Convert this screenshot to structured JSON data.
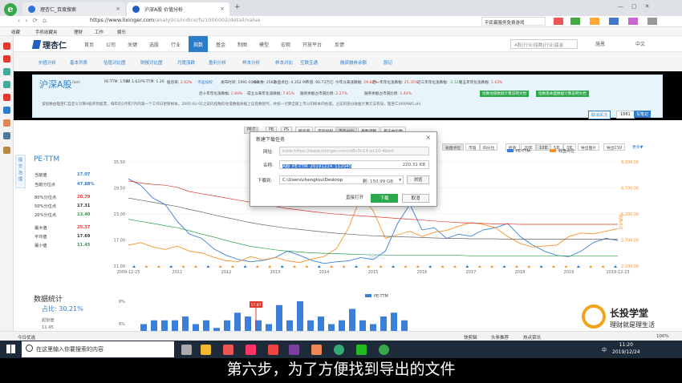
{
  "browser": {
    "tabs": [
      {
        "label": "理杏仁_百度搜索",
        "icon_color": "#2f6fd8"
      },
      {
        "label": "沪深A股 价值分析",
        "icon_color": "#1f5fbf"
      }
    ],
    "new_tab": "+",
    "url_host": "https://www.lixinger.com",
    "url_path": "/analytics/indice/fs/1000002/detail/value",
    "right_search": "平民霸服务免费游戏",
    "bookmarks": [
      "收藏",
      "手机收藏夹",
      "理财",
      "工作",
      "娱乐"
    ]
  },
  "site": {
    "logo": "理杏仁",
    "nav": [
      "首页",
      "公司",
      "关键",
      "选股",
      "行业",
      "指数",
      "基金",
      "制图",
      "模型",
      "宏观",
      "开放平台",
      "反馈"
    ],
    "nav_active": "指数",
    "search_placeholder": "A股(行业)指数|行业|基金",
    "user": "施恩",
    "lang": "中文"
  },
  "subnav": [
    "价值分析",
    "基本列表",
    "估值对比图",
    "财报对比图",
    "月度涨跌",
    "盈利分析",
    "样本分析",
    "样本对比",
    "互联互通",
    "融资融券余额",
    "股记"
  ],
  "info": {
    "title": "沪深A股",
    "code": "(lxr)",
    "row1": [
      {
        "k": "PE-TTM:",
        "v": "17.07"
      },
      {
        "k": "PB:",
        "v": "1.63"
      },
      {
        "k": "PS-TTM:",
        "v": "1.26"
      },
      {
        "k": "股息率:",
        "v": "2.02%"
      },
      {
        "k": "",
        "v": "·市盈加权"
      },
      {
        "k": "发布时间:",
        "v": "1991-01-01"
      },
      {
        "k": "样本数:",
        "v": "3565"
      },
      {
        "k": "收盘点位:",
        "v": "4,352.99"
      },
      {
        "k": "市值:",
        "v": "60.73万亿"
      },
      {
        "k": "今年以来涨跌幅:",
        "v": "29.82%"
      },
      {
        "k": "近一年年化涨跌幅:",
        "v": "25.35%"
      },
      {
        "k": "近三年年化涨跌幅:",
        "v": "-3.12%"
      },
      {
        "k": "近五年年化涨跌幅:",
        "v": "1.43%"
      }
    ],
    "row2": [
      {
        "k": "近十年年化涨跌幅:",
        "v": "2.89%"
      },
      {
        "k": "成立以来年化涨跌幅:",
        "v": "7.81%"
      },
      {
        "k": "融资余额占市值比例:",
        "v": "2.27%"
      },
      {
        "k": "融券余额占市值比例:",
        "v": "1.44%"
      }
    ],
    "green_buttons": [
      "指数估值数据计算说明文档",
      "指数基本面数据计算说明文档"
    ],
    "desc": "该指数由理杏仁自定义计算A股所有股票，每年的1月和7月的第一个工作日更新样本。2005-01-01之前的指数的估值数据依据上证指数替代，并统一计算全部上市公司样本的估值。之前的部分收益计算方法有误，理杏仁(000985.sh)",
    "follow": [
      "取消关注",
      "1881",
      "写笔记"
    ]
  },
  "dialog": {
    "title": "新建下载任务",
    "url_label": "网址:",
    "url_value": "blob:https://www.lixinger.com/d8c0c14-bc10-4be4",
    "name_label": "名称:",
    "name_value": "A股_PE-TTM_20191224_112045",
    "size": "220.31 KB",
    "dest_label": "下载到:",
    "dest_value": "C:\\Users\\chengtou\\Desktop",
    "free_space": "剩: 150.99 GB",
    "browse": "浏览",
    "open_direct": "直接打开",
    "download": "下载",
    "cancel": "取消"
  },
  "toolbar": {
    "row": [
      "收盘点位",
      "市值",
      "四分位",
      "所有",
      "20年",
      "10年",
      "5年",
      "3年",
      "导出图片",
      "导出CSV"
    ],
    "selected": "10年",
    "more": "更多▼",
    "pe_button": "PE-TTM",
    "partial_buttons": [
      "PE-T",
      "PB",
      "PS",
      "股息率",
      "市盈加权",
      "市盈分位",
      "基数调整",
      "基于中位数"
    ]
  },
  "pe_panel": {
    "title": "PE-TTM",
    "rows": [
      {
        "k": "当前值",
        "v": "17.07",
        "c": "#2d7ccb"
      },
      {
        "k": "当前分位点",
        "v": "47.88%",
        "c": "#2d7ccb"
      },
      {
        "k": "80%分位点",
        "v": "20.79",
        "c": "#e23b2e"
      },
      {
        "k": "50%分位点",
        "v": "17.31",
        "c": "#333333"
      },
      {
        "k": "20%分位点",
        "v": "13.40",
        "c": "#2a9d4a"
      },
      {
        "k": "最大值",
        "v": "25.37",
        "c": "#e23b2e"
      },
      {
        "k": "平均值",
        "v": "17.69",
        "c": "#333333"
      },
      {
        "k": "最小值",
        "v": "11.45",
        "c": "#2a9d4a"
      }
    ],
    "side_tools": [
      "提",
      "交",
      "治",
      "理"
    ]
  },
  "chart_data": {
    "type": "line",
    "x": [
      "2009-12-25",
      "2011",
      "2012",
      "2013",
      "2014",
      "2015",
      "2016",
      "2017",
      "2018",
      "2019",
      "2019-12-23"
    ],
    "y_left_ticks": [
      "35.50",
      "29.50",
      "23.00",
      "17.00",
      "11.00"
    ],
    "y_right_ticks": [
      "8,200.00",
      "6,700.00",
      "5,200.00",
      "3,700.00",
      "2,200.00"
    ],
    "right_axis_label": "收盘点位",
    "legend": [
      "PE-TTM",
      "收盘点位"
    ],
    "series": [
      {
        "name": "PE-TTM",
        "color": "#3a7fd8",
        "values": [
          31.5,
          30,
          27,
          25.5,
          21.5,
          18.5,
          17.5,
          15,
          13.5,
          12.5,
          12,
          12.3,
          13,
          14.5,
          13.5,
          12.3,
          11.6,
          12,
          12.2,
          13,
          12.5,
          14.5,
          21,
          25.5,
          19.5,
          20,
          17.5,
          18.5,
          18,
          19.5,
          20,
          21,
          18,
          16,
          14.5,
          13.5,
          13.2,
          14.5,
          16.5,
          17.5,
          17
        ]
      },
      {
        "name": "收盘点位",
        "color": "#f5932a",
        "values": [
          3400,
          3550,
          3300,
          3150,
          3350,
          3050,
          2950,
          2700,
          2500,
          2450,
          2750,
          2550,
          2700,
          2500,
          2400,
          2600,
          2750,
          3200,
          4400,
          6200,
          5400,
          3800,
          4000,
          4200,
          3900,
          4150,
          4250,
          4500,
          4700,
          4600,
          4400,
          3900,
          3500,
          3300,
          3350,
          3400,
          3900,
          4100,
          4050,
          4200,
          4352
        ]
      },
      {
        "name": "80%分位",
        "color": "#e23b2e",
        "values": [
          31,
          30.5,
          30.2,
          30,
          29.5,
          28.5,
          28,
          27.5,
          27,
          26.5,
          26,
          25.5,
          25,
          24.5,
          24.2,
          23.8,
          23.5,
          23.2,
          23,
          22.8,
          22.6,
          22.4,
          22.2,
          22,
          21.8,
          21.6,
          21.4,
          21.2,
          21.1,
          21,
          20.9,
          20.9,
          20.8,
          20.8,
          20.8,
          20.8,
          20.8,
          20.8,
          20.8,
          20.8,
          20.8
        ]
      },
      {
        "name": "50%分位",
        "color": "#666666",
        "values": [
          27,
          26.5,
          26,
          25.5,
          25,
          24.3,
          23.7,
          23,
          22.4,
          21.8,
          21.2,
          20.7,
          20.3,
          19.9,
          19.6,
          19.3,
          19,
          18.7,
          18.5,
          18.3,
          18.1,
          18,
          17.9,
          17.8,
          17.7,
          17.6,
          17.5,
          17.5,
          17.4,
          17.4,
          17.4,
          17.3,
          17.3,
          17.3,
          17.3,
          17.3,
          17.3,
          17.3,
          17.3,
          17.3,
          17.3
        ]
      },
      {
        "name": "20%分位",
        "color": "#2a9d4a",
        "values": [
          22,
          21.5,
          21,
          20.5,
          20,
          19.3,
          18.5,
          17.8,
          17,
          16.3,
          15.6,
          15.2,
          14.8,
          14.5,
          14.3,
          14.1,
          14,
          13.9,
          13.8,
          13.7,
          13.6,
          13.6,
          13.5,
          13.5,
          13.5,
          13.5,
          13.5,
          13.5,
          13.4,
          13.4,
          13.4,
          13.4,
          13.4,
          13.4,
          13.4,
          13.4,
          13.4,
          13.4,
          13.4,
          13.4,
          13.4
        ]
      }
    ],
    "y_left_range": [
      11,
      35.5
    ],
    "y_right_range": [
      2200,
      8200
    ],
    "watermark": "理杏仁"
  },
  "stats_section": {
    "title": "数据统计",
    "pct": "占比: 30.21%",
    "sub1": "起始值",
    "sub2": "11.45",
    "marker": "17.87",
    "hist_ticks": [
      "8%",
      "6%"
    ],
    "legend": "PE-TTM",
    "hist_values": [
      2,
      3,
      3,
      3,
      4,
      2,
      3,
      1,
      3,
      5,
      4,
      3,
      2,
      7,
      3,
      8,
      3,
      4,
      2,
      3,
      6,
      3,
      2,
      4,
      5,
      3
    ]
  },
  "statusbar": {
    "left": "今日优选",
    "items": [
      "快剪辑",
      "头条推荐",
      "热点资讯"
    ],
    "zoom": "100%"
  },
  "taskbar": {
    "search": "在这里输入你要搜索的内容",
    "time": "11:20",
    "date": "2019/12/24",
    "lang": "中"
  },
  "brand": {
    "name": "长投学堂",
    "slogan": "理财就是理生活"
  },
  "caption": "第六步，为了方便找到导出的文件"
}
